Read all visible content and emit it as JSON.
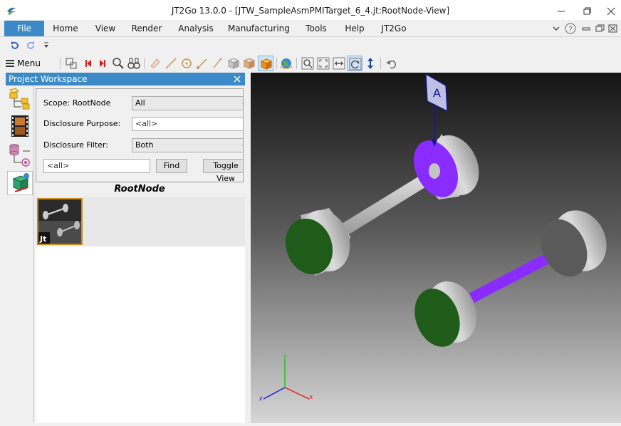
{
  "window": {
    "title": "JT2Go 13.0.0 - [JTW_SampleAsmPMITarget_6_4.jt:RootNode-View]",
    "controls": [
      "minimize-icon",
      "restore-icon",
      "close-icon"
    ]
  },
  "ribbon": {
    "tabs": [
      {
        "label": "File",
        "active": true
      },
      {
        "label": "Home"
      },
      {
        "label": "View"
      },
      {
        "label": "Render"
      },
      {
        "label": "Analysis"
      },
      {
        "label": "Manufacturing"
      },
      {
        "label": "Tools"
      },
      {
        "label": "Help"
      },
      {
        "label": "JT2Go"
      }
    ],
    "right_icons": [
      "chevron-down-icon",
      "help-icon",
      "minimize-icon",
      "restore-icon",
      "close-icon"
    ]
  },
  "quick_access": {
    "icons": [
      "undo-icon",
      "redo-icon",
      "customize-icon"
    ]
  },
  "toolbar": {
    "menu_label": "Menu",
    "icons": [
      "fit-select-icon",
      "previous-icon",
      "next-icon",
      "zoom-area-icon",
      "binoculars-icon",
      "pmi-pick-icon",
      "line-icon",
      "circle-icon",
      "measure-icon",
      "sketch-icon",
      "cube-shaded-icon",
      "cube-box-icon",
      "cube-orange-icon",
      "globe-icon",
      "zoom-window-icon",
      "fit-all-icon",
      "pan-icon",
      "rotate-icon",
      "vertical-icon",
      "undo-view-icon"
    ]
  },
  "workspace": {
    "title": "Project Workspace",
    "side_icons": [
      "assembly-tree-icon",
      "film-icon",
      "database-icon",
      "pmi-views-icon"
    ],
    "filter": {
      "scope_label": "Scope: RootNode",
      "scope_value": "All",
      "purpose_label": "Disclosure Purpose:",
      "purpose_value": "<all>",
      "filter_label": "Disclosure Filter:",
      "filter_value": "Both",
      "search_value": "<all>",
      "find_label": "Find",
      "toggle_label": "Toggle View"
    },
    "root_label": "RootNode",
    "thumbnail_badge": "Jt"
  },
  "viewport": {
    "datum_label": "A",
    "axes": {
      "x": "x",
      "y": "y",
      "z": "z"
    },
    "colors": {
      "green_face": "#1f5c1a",
      "purple_face": "#8a2cff",
      "gray": "#cfcfcf",
      "datum": "#16168a"
    }
  }
}
